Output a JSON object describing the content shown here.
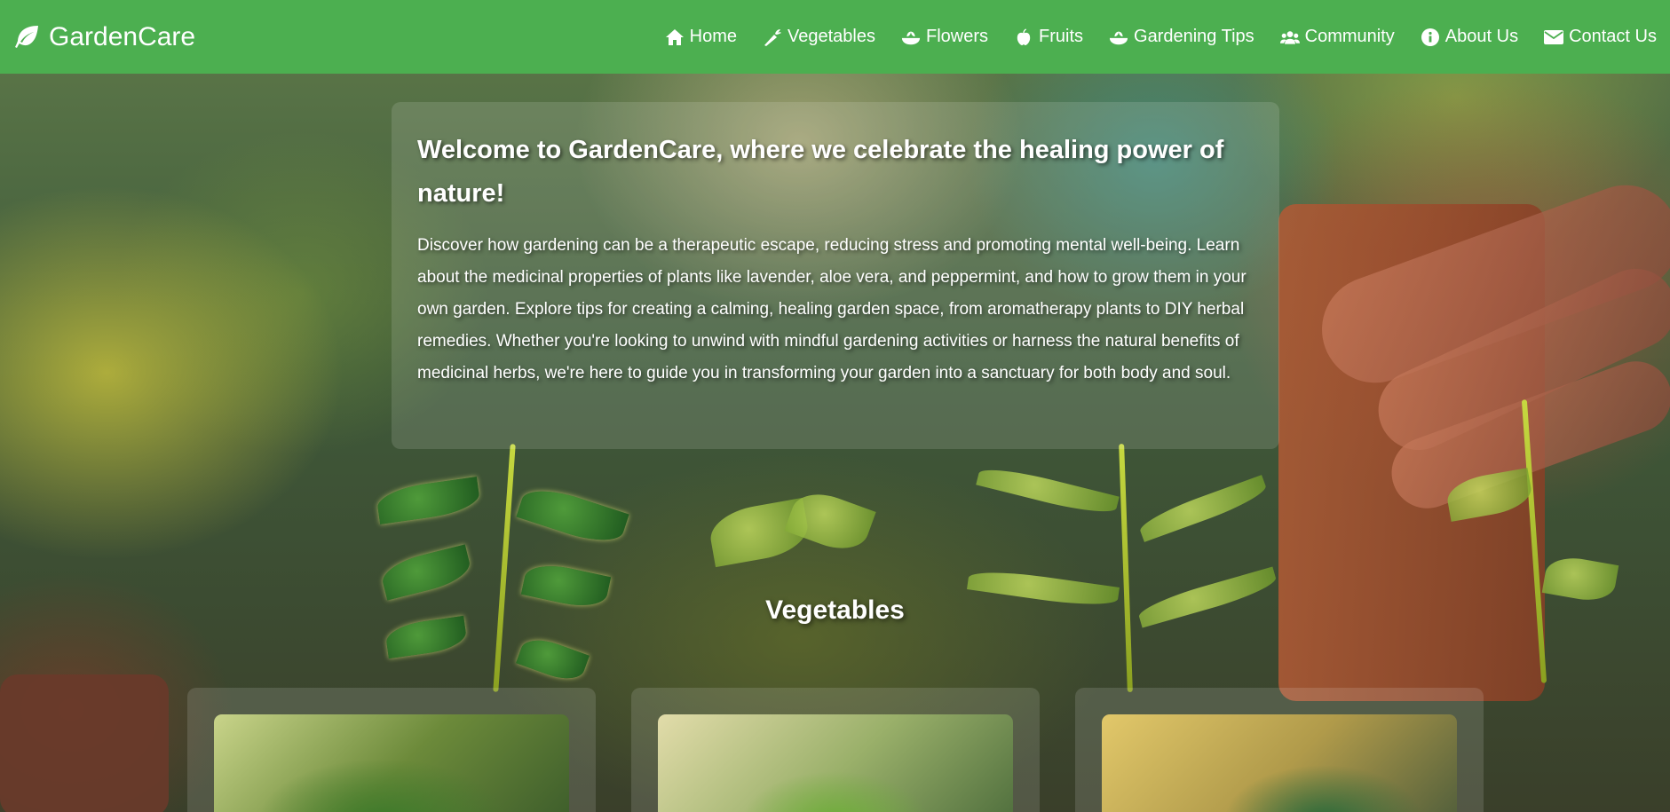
{
  "brand": {
    "name": "GardenCare",
    "icon": "leaf-icon"
  },
  "nav": {
    "items": [
      {
        "label": "Home",
        "icon": "home-icon"
      },
      {
        "label": "Vegetables",
        "icon": "carrot-icon"
      },
      {
        "label": "Flowers",
        "icon": "seedling-icon"
      },
      {
        "label": "Fruits",
        "icon": "apple-icon"
      },
      {
        "label": "Gardening Tips",
        "icon": "seedling-icon"
      },
      {
        "label": "Community",
        "icon": "users-icon"
      },
      {
        "label": "About Us",
        "icon": "info-icon"
      },
      {
        "label": "Contact Us",
        "icon": "envelope-icon"
      }
    ]
  },
  "welcome": {
    "heading": "Welcome to GardenCare, where we celebrate the healing power of nature!",
    "body": "Discover how gardening can be a therapeutic escape, reducing stress and promoting mental well-being. Learn about the medicinal properties of plants like lavender, aloe vera, and peppermint, and how to grow them in your own garden. Explore tips for creating a calming, healing garden space, from aromatherapy plants to DIY herbal remedies. Whether you're looking to unwind with mindful gardening activities or harness the natural benefits of medicinal herbs, we're here to guide you in transforming your garden into a sanctuary for both body and soul."
  },
  "section": {
    "title": "Vegetables"
  },
  "colors": {
    "navbar": "#4caf50",
    "text": "#ffffff"
  }
}
